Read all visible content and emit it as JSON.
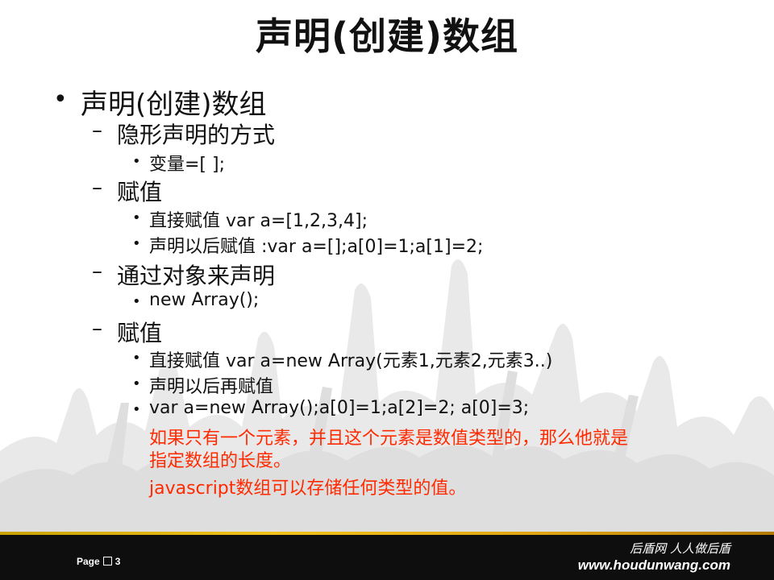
{
  "slide": {
    "title": "声明(创建)数组",
    "items": [
      {
        "level": 1,
        "text": "声明(创建)数组"
      },
      {
        "level": 2,
        "text": "隐形声明的方式"
      },
      {
        "level": 3,
        "text": "变量=[ ];"
      },
      {
        "level": 2,
        "text": "赋值"
      },
      {
        "level": 3,
        "text": "直接赋值   var a=[1,2,3,4];"
      },
      {
        "level": 3,
        "text": "声明以后赋值 :var a=[];a[0]=1;a[1]=2;"
      },
      {
        "level": 2,
        "text": "通过对象来声明"
      },
      {
        "level": 3,
        "text": "new Array();"
      },
      {
        "level": 2,
        "text": "赋值"
      },
      {
        "level": 3,
        "text": "直接赋值  var a=new Array(元素1,元素2,元素3..)"
      },
      {
        "level": 3,
        "text": "声明以后再赋值"
      },
      {
        "level": 3,
        "text": "var a=new Array();a[0]=1;a[2]=2;  a[0]=3;"
      }
    ],
    "notes": [
      "如果只有一个元素，并且这个元素是数值类型的，那么他就是",
      "指定数组的长度。",
      "javascript数组可以存储任何类型的值。"
    ],
    "note_color": "#ff2a00"
  },
  "footer": {
    "page_prefix": "Page",
    "page_number": "3",
    "brand_slogan": "后盾网 人人做后盾",
    "brand_url": "www.houdunwang.com",
    "accent": "#f2c21b"
  }
}
